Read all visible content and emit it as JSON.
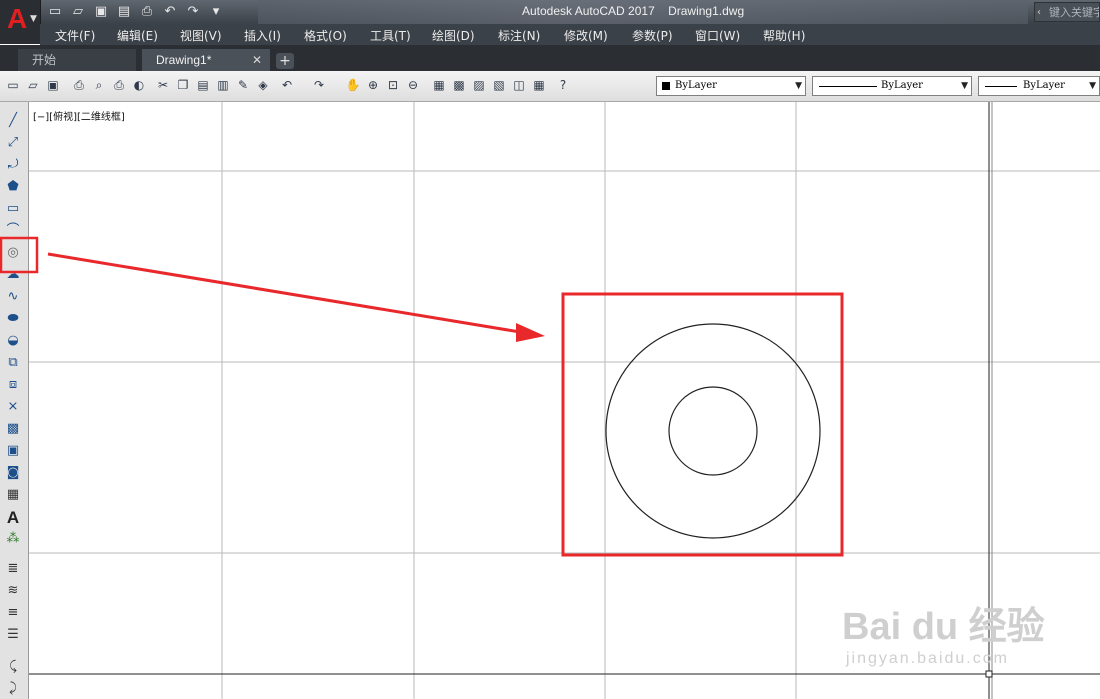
{
  "window": {
    "title": "Autodesk AutoCAD 2017    Drawing1.dwg",
    "app_logo": "A",
    "search_placeholder": "键入关键字"
  },
  "quick_access": [
    "new-icon",
    "open-icon",
    "save-icon",
    "saveas-icon",
    "print-icon",
    "undo-icon",
    "redo-icon",
    "dropdown-icon"
  ],
  "menu": [
    "文件(F)",
    "编辑(E)",
    "视图(V)",
    "插入(I)",
    "格式(O)",
    "工具(T)",
    "绘图(D)",
    "标注(N)",
    "修改(M)",
    "参数(P)",
    "窗口(W)",
    "帮助(H)"
  ],
  "tabs": [
    {
      "label": "开始"
    },
    {
      "label": "Drawing1*",
      "close": "✕"
    }
  ],
  "tab_add": "+",
  "properties": {
    "color": "ByLayer",
    "linetype": "ByLayer",
    "lineweight": "ByLayer"
  },
  "viewport_label": "[−][俯视][二维线框]",
  "left_toolbar": [
    "line-icon",
    "construction-line-icon",
    "polyline-icon",
    "polygon-icon",
    "rectangle-icon",
    "arc-icon",
    "circle-icon",
    "revision-cloud-icon",
    "spline-icon",
    "ellipse-icon",
    "ellipse-arc-icon",
    "insert-block-icon",
    "make-block-icon",
    "point-icon",
    "hatch-icon",
    "gradient-icon",
    "region-icon",
    "table-icon",
    "text-icon",
    "add-selected-icon",
    "layer-icon",
    "layer-previous-icon",
    "layer-match-icon",
    "layer-isolate-icon",
    "dim-linear-icon",
    "dim-aligned-icon"
  ],
  "drawing": {
    "outer_circle_radius": 107,
    "inner_circle_radius": 44
  },
  "watermark": {
    "brand": "Bai du 经验",
    "url": "jingyan.baidu.com"
  },
  "colors": {
    "annotation": "#e8282a",
    "grid": "#b9b9b9"
  }
}
